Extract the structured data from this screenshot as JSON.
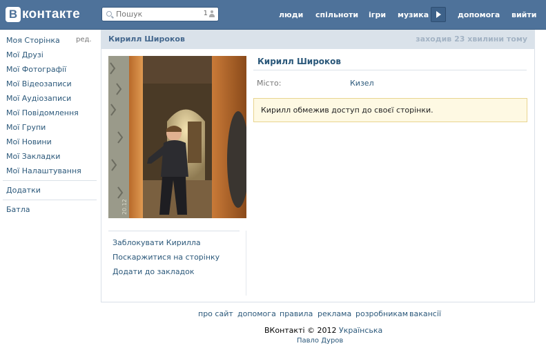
{
  "header": {
    "logo_b": "В",
    "logo_text": "контакте",
    "search_placeholder": "Пошук",
    "search_count": "1",
    "nav": [
      "люди",
      "спільноти",
      "ігри",
      "музика",
      "допомога",
      "вийти"
    ]
  },
  "sidebar": {
    "edit_label": "ред.",
    "items": [
      "Моя Сторінка",
      "Мої Друзі",
      "Мої Фотографії",
      "Мої Відеозаписи",
      "Мої Аудіозаписи",
      "Мої Повідомлення",
      "Мої Групи",
      "Мої Новини",
      "Мої Закладки",
      "Мої Налаштування"
    ],
    "apps": "Додатки",
    "extra": "Батла"
  },
  "profile": {
    "head_name": "Кирилл Широков",
    "last_seen": "заходив 23 хвилини тому",
    "name": "Кирилл Широков",
    "city_label": "Місто:",
    "city_value": "Кизел",
    "notice": "Кирилл обмежив доступ до своєї сторінки.",
    "actions": [
      "Заблокувати Кирилла",
      "Поскаржитися на сторінку",
      "Додати до закладок"
    ],
    "photo_stamp": "20.12"
  },
  "footer": {
    "links": [
      "про сайт",
      "допомога",
      "правила",
      "реклама",
      "розробникам",
      "вакансії"
    ],
    "copyright": "ВКонтакті © 2012",
    "language": "Українська",
    "author": "Павло Дуров"
  },
  "colors": {
    "header_bg": "#4E729A",
    "link": "#2B587A",
    "notice_bg": "#FEF9E3"
  }
}
